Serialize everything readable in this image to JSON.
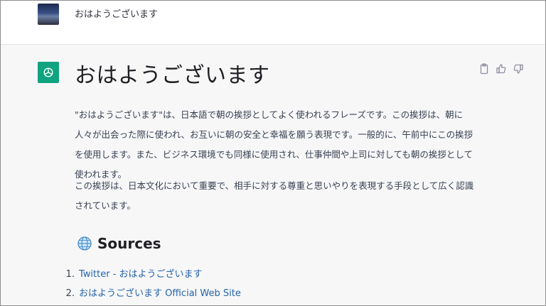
{
  "user_message": {
    "text": "おはようございます"
  },
  "assistant": {
    "heading": "おはようございます",
    "paragraphs": [
      "\"おはようございます\"は、日本語で朝の挨拶としてよく使われるフレーズです。この挨拶は、朝に人々が出会った際に使われ、お互いに朝の安全と幸福を願う表現です。一般的に、午前中にこの挨拶を使用します。また、ビジネス環境でも同様に使用され、仕事仲間や上司に対しても朝の挨拶として使われます。",
      "この挨拶は、日本文化において重要で、相手に対する尊重と思いやりを表現する手段として広く認識されています。"
    ],
    "sources_title": "Sources",
    "sources": [
      {
        "num": "1.",
        "label": "Twitter - おはようございます"
      },
      {
        "num": "2.",
        "label": "おはようございます Official Web Site"
      }
    ]
  },
  "icons": {
    "bot": "openai-logo-icon",
    "actions": [
      "clipboard-icon",
      "thumbs-up-icon",
      "thumbs-down-icon"
    ],
    "sources": "globe-icon"
  },
  "colors": {
    "bot_avatar": "#10a37f",
    "link": "#2563a8",
    "background": "#f7f7f8"
  }
}
